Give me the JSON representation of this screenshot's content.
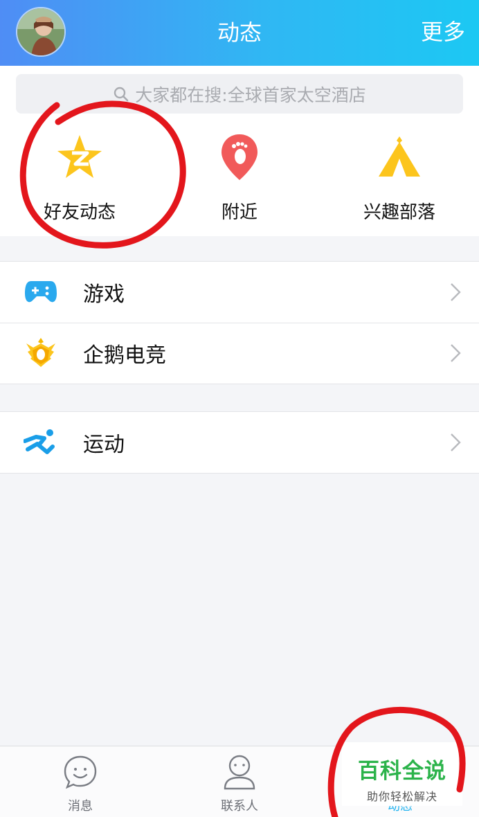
{
  "header": {
    "title": "动态",
    "more_label": "更多"
  },
  "search": {
    "placeholder": "大家都在搜:全球首家太空酒店"
  },
  "quick_actions": [
    {
      "label": "好友动态",
      "icon": "qzone-star-icon"
    },
    {
      "label": "附近",
      "icon": "footprint-pin-icon"
    },
    {
      "label": "兴趣部落",
      "icon": "tent-icon"
    }
  ],
  "list_section_1": [
    {
      "label": "游戏",
      "icon": "gamepad-icon"
    },
    {
      "label": "企鹅电竞",
      "icon": "esports-badge-icon"
    }
  ],
  "list_section_2": [
    {
      "label": "运动",
      "icon": "runner-icon"
    }
  ],
  "tabbar": [
    {
      "label": "消息",
      "icon": "chat-bubble-icon"
    },
    {
      "label": "联系人",
      "icon": "person-icon"
    },
    {
      "label": "动态",
      "icon": "star-icon",
      "active": true
    }
  ],
  "watermark": {
    "title": "百科全说",
    "subtitle": "助你轻松解决"
  },
  "colors": {
    "header_gradient_start": "#4f8df5",
    "header_gradient_end": "#1cc8f3",
    "annotation_red": "#e3161c",
    "active_tab": "#21b3f0",
    "watermark_green": "#2bb34a"
  }
}
